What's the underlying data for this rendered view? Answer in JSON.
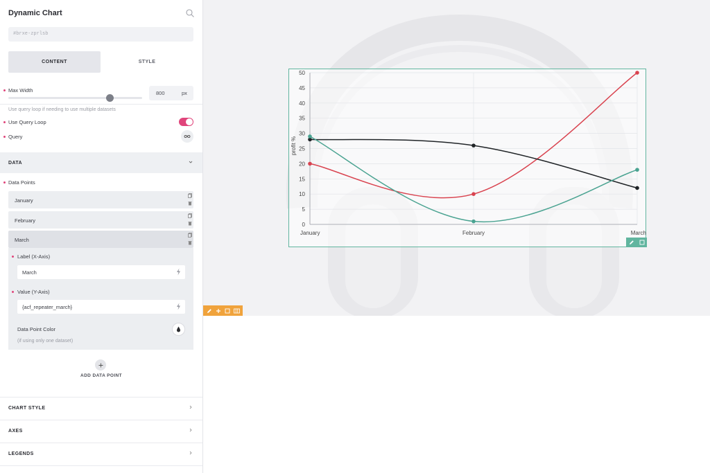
{
  "panel": {
    "title": "Dynamic Chart",
    "element_id": "#brxe-zprlsb",
    "tabs": [
      {
        "label": "CONTENT",
        "active": true
      },
      {
        "label": "STYLE",
        "active": false
      }
    ],
    "max_width": {
      "label": "Max Width",
      "value": "800",
      "unit": "px",
      "slider_fraction": 0.76
    },
    "query_hint": "Use query loop if needing to use multiple datasets",
    "use_query_loop": {
      "label": "Use Query Loop",
      "on": true
    },
    "query_label": "Query",
    "data_section": "DATA",
    "data_points_label": "Data Points",
    "data_points": [
      "January",
      "February",
      "March"
    ],
    "expanded_point": {
      "label_field_label": "Label (X-Axis)",
      "label_value": "March",
      "value_field_label": "Value (Y-Axis)",
      "value_value": "{acf_repeater_march}",
      "color_label": "Data Point Color",
      "color_hint": "(if using only one dataset)"
    },
    "add_label": "ADD DATA POINT",
    "sections": [
      "CHART STYLE",
      "AXES",
      "LEGENDS"
    ]
  },
  "colors": {
    "accent_pink": "#e0457b",
    "frame_green": "#61b59f",
    "toolbar_orange": "#f0a33c"
  },
  "chart_data": {
    "type": "line",
    "categories": [
      "January",
      "February",
      "March"
    ],
    "ylabel": "profit %",
    "ylim": [
      0,
      50
    ],
    "yticks": [
      0,
      5,
      10,
      15,
      20,
      25,
      30,
      35,
      40,
      45,
      50
    ],
    "grid": true,
    "series": [
      {
        "color": "#d9434f",
        "values": [
          20,
          10,
          50
        ]
      },
      {
        "color": "#1f2326",
        "values": [
          28,
          26,
          12
        ]
      },
      {
        "color": "#4aa391",
        "values": [
          29,
          1,
          18
        ]
      }
    ]
  }
}
